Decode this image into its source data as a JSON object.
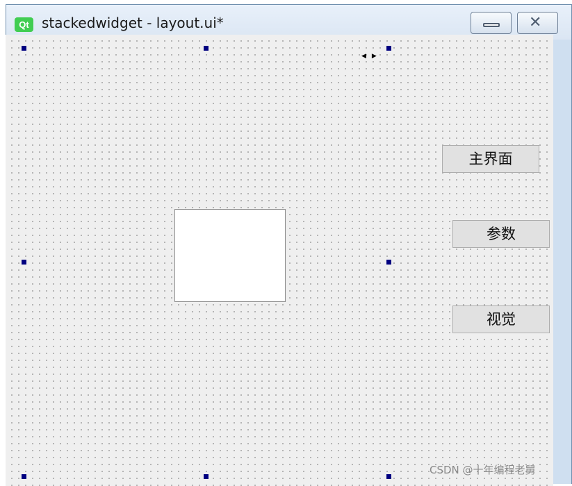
{
  "window": {
    "app_icon": "qt-logo-icon",
    "app_icon_text": "Qt",
    "title": "stackedwidget - layout.ui*",
    "minimize_icon": "minimize-icon",
    "close_icon": "close-icon"
  },
  "form": {
    "buttons": [
      {
        "label": "主界面"
      },
      {
        "label": "参数"
      },
      {
        "label": "视觉"
      }
    ]
  },
  "watermark": "CSDN @十年编程老舅",
  "colors": {
    "selection_handle": "#000080",
    "qt_green": "#41cd52",
    "canvas": "#efefef"
  }
}
